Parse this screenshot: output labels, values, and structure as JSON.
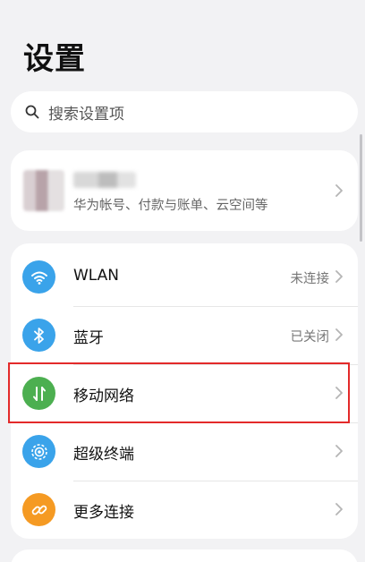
{
  "header": {
    "title": "设置"
  },
  "search": {
    "placeholder": "搜索设置项",
    "icon": "search-icon"
  },
  "account": {
    "subtitle": "华为帐号、付款与账单、云空间等"
  },
  "settings": {
    "items": [
      {
        "label": "WLAN",
        "value": "未连接",
        "icon": "wifi-icon",
        "color": "#3aa3ea"
      },
      {
        "label": "蓝牙",
        "value": "已关闭",
        "icon": "bluetooth-icon",
        "color": "#3aa3ea"
      },
      {
        "label": "移动网络",
        "value": "",
        "icon": "mobile-data-icon",
        "color": "#4caf50"
      },
      {
        "label": "超级终端",
        "value": "",
        "icon": "super-device-icon",
        "color": "#3aa3ea"
      },
      {
        "label": "更多连接",
        "value": "",
        "icon": "link-icon",
        "color": "#f59a23"
      }
    ]
  },
  "colors": {
    "highlight": "#e32a2a",
    "background": "#f2f2f4"
  }
}
